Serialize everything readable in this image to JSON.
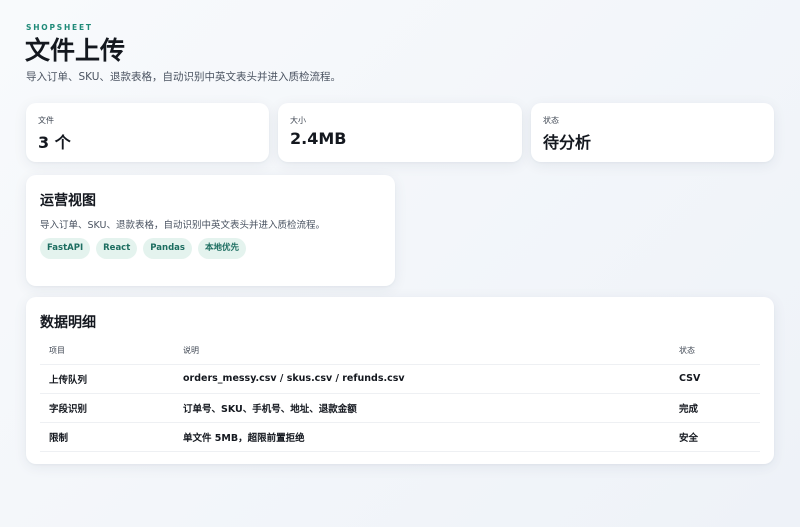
{
  "header": {
    "brand": "SHOPSHEET",
    "title": "文件上传",
    "subtitle": "导入订单、SKU、退款表格，自动识别中英文表头并进入质检流程。"
  },
  "stats": [
    {
      "label": "文件",
      "value": "3 个"
    },
    {
      "label": "大小",
      "value": "2.4MB"
    },
    {
      "label": "状态",
      "value": "待分析"
    }
  ],
  "ops": {
    "title": "运营视图",
    "description": "导入订单、SKU、退款表格，自动识别中英文表头并进入质检流程。",
    "tags": [
      "FastAPI",
      "React",
      "Pandas",
      "本地优先"
    ]
  },
  "details": {
    "title": "数据明细",
    "columns": [
      "项目",
      "说明",
      "状态"
    ],
    "rows": [
      [
        "上传队列",
        "orders_messy.csv / skus.csv / refunds.csv",
        "CSV"
      ],
      [
        "字段识别",
        "订单号、SKU、手机号、地址、退款金额",
        "完成"
      ],
      [
        "限制",
        "单文件 5MB，超限前置拒绝",
        "安全"
      ]
    ]
  },
  "colors": {
    "accent": "#1f8a78",
    "tag_bg": "#e4f3ee",
    "tag_text": "#1d6e61",
    "background": "#f1f4f9"
  }
}
